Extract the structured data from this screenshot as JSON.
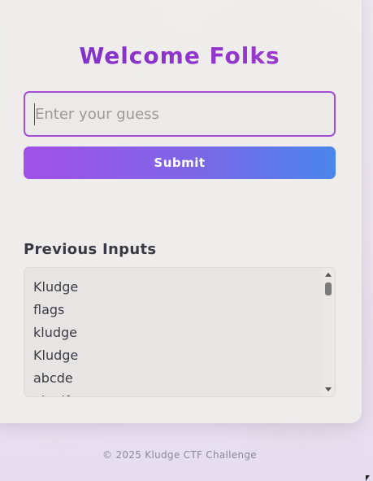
{
  "header": {
    "title": "Welcome Folks"
  },
  "guess_input": {
    "placeholder": "Enter your guess",
    "value": ""
  },
  "submit_button": {
    "label": "Submit"
  },
  "previous_inputs": {
    "heading": "Previous Inputs",
    "items": [
      "Kludge",
      "flags",
      "kludge",
      "Kludge",
      "abcde",
      "abcdf"
    ]
  },
  "footer": {
    "text": "© 2025 Kludge CTF Challenge"
  },
  "colors": {
    "title": "#8d33c9",
    "input_border": "#a24fd6",
    "button_gradient_start": "#a151e6",
    "button_gradient_end": "#4a86ec"
  }
}
